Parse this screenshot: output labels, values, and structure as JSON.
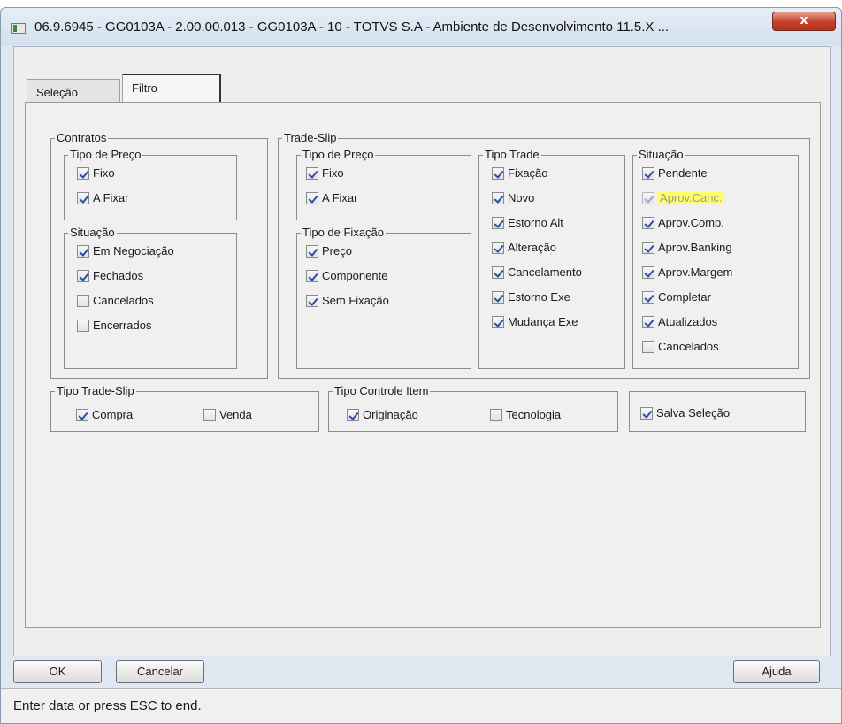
{
  "window": {
    "title": "06.9.6945 - GG0103A - 2.00.00.013 - GG0103A - 10 - TOTVS S.A - Ambiente de Desenvolvimento 11.5.X ...",
    "close_label": "x"
  },
  "tabs": [
    {
      "label": "Seleção"
    },
    {
      "label": "Filtro"
    }
  ],
  "groups": {
    "contratos": {
      "label": "Contratos",
      "tipo_preco": {
        "label": "Tipo de Preço",
        "items": [
          {
            "label": "Fixo",
            "checked": true
          },
          {
            "label": "A Fixar",
            "checked": true
          }
        ]
      },
      "situacao": {
        "label": "Situação",
        "items": [
          {
            "label": "Em Negociação",
            "checked": true
          },
          {
            "label": "Fechados",
            "checked": true
          },
          {
            "label": "Cancelados",
            "checked": false
          },
          {
            "label": "Encerrados",
            "checked": false
          }
        ]
      }
    },
    "trade_slip": {
      "label": "Trade-Slip",
      "tipo_preco": {
        "label": "Tipo de Preço",
        "items": [
          {
            "label": "Fixo",
            "checked": true
          },
          {
            "label": "A Fixar",
            "checked": true
          }
        ]
      },
      "tipo_fixacao": {
        "label": "Tipo de Fixação",
        "items": [
          {
            "label": "Preço",
            "checked": true
          },
          {
            "label": "Componente",
            "checked": true
          },
          {
            "label": "Sem Fixação",
            "checked": true
          }
        ]
      },
      "tipo_trade": {
        "label": "Tipo Trade",
        "items": [
          {
            "label": "Fixação",
            "checked": true
          },
          {
            "label": "Novo",
            "checked": true
          },
          {
            "label": "Estorno Alt",
            "checked": true
          },
          {
            "label": "Alteração",
            "checked": true
          },
          {
            "label": "Cancelamento",
            "checked": true
          },
          {
            "label": "Estorno Exe",
            "checked": true
          },
          {
            "label": "Mudança Exe",
            "checked": true
          }
        ]
      },
      "situacao": {
        "label": "Situação",
        "items": [
          {
            "label": "Pendente",
            "checked": true
          },
          {
            "label": "Aprov.Canc.",
            "checked": true,
            "disabled": true,
            "highlight": true
          },
          {
            "label": "Aprov.Comp.",
            "checked": true
          },
          {
            "label": "Aprov.Banking",
            "checked": true
          },
          {
            "label": "Aprov.Margem",
            "checked": true
          },
          {
            "label": "Completar",
            "checked": true
          },
          {
            "label": "Atualizados",
            "checked": true
          },
          {
            "label": "Cancelados",
            "checked": false
          }
        ]
      }
    },
    "tipo_trade_slip": {
      "label": "Tipo Trade-Slip",
      "items": [
        {
          "label": "Compra",
          "checked": true
        },
        {
          "label": "Venda",
          "checked": false
        }
      ]
    },
    "tipo_controle_item": {
      "label": "Tipo Controle Item",
      "items": [
        {
          "label": "Originação",
          "checked": true
        },
        {
          "label": "Tecnologia",
          "checked": false
        }
      ]
    },
    "salva": {
      "items": [
        {
          "label": "Salva Seleção",
          "checked": true
        }
      ]
    }
  },
  "buttons": {
    "ok": "OK",
    "cancelar": "Cancelar",
    "ajuda": "Ajuda"
  },
  "status": {
    "text": "Enter data or press ESC to end."
  },
  "colors": {
    "highlight": "#ffff66",
    "check": "#2b4ea8",
    "close": "#c4402a"
  }
}
